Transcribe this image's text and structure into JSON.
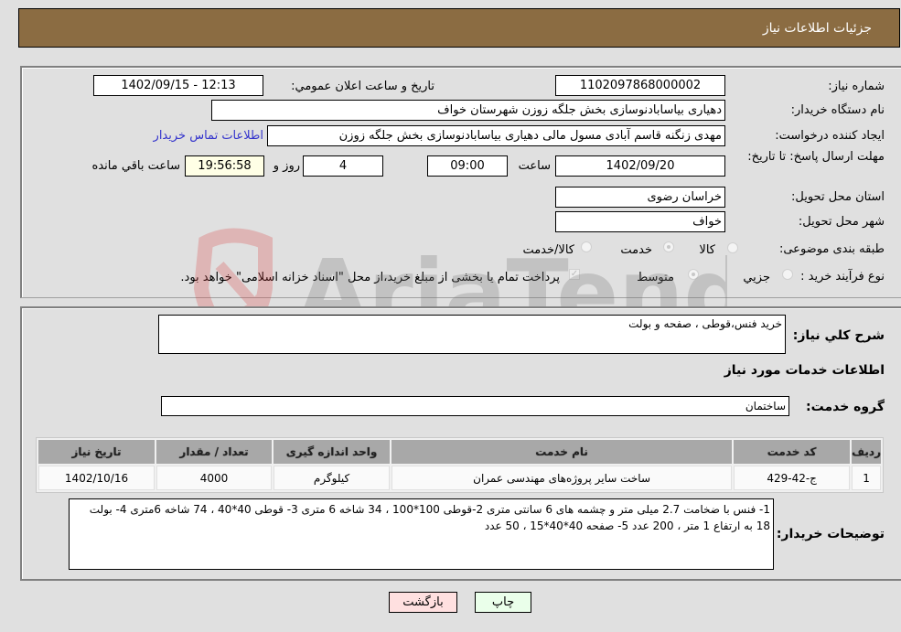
{
  "header": {
    "title": "جزئیات اطلاعات نیاز"
  },
  "fields": {
    "need_number": {
      "label": "شماره نیاز:",
      "value": "1102097868000002"
    },
    "announce_datetime": {
      "label": "تاریخ و ساعت اعلان عمومي:",
      "value": "1402/09/15 - 12:13"
    },
    "buyer_org": {
      "label": "نام دستگاه خریدار:",
      "value": "دهیاری بیاسابادنوسازی بخش جلگه زوزن شهرستان خواف"
    },
    "requester": {
      "label": "ایجاد کننده درخواست:",
      "value": "مهدی زنگنه قاسم آبادی مسول مالی دهیاری بیاسابادنوسازی بخش جلگه زوزن"
    },
    "buyer_contact_link": "اطلاعات تماس خریدار",
    "deadline": {
      "label": "مهلت ارسال پاسخ: تا تاریخ:",
      "date": "1402/09/20",
      "time_label": "ساعت",
      "time": "09:00",
      "days": "4",
      "days_label": "روز و",
      "remaining": "19:56:58",
      "remaining_label": "ساعت باقي مانده"
    },
    "province": {
      "label": "استان محل تحویل:",
      "value": "خراسان رضوی"
    },
    "city": {
      "label": "شهر محل تحویل:",
      "value": "خواف"
    },
    "category": {
      "label": "طبقه بندی موضوعی:",
      "options": [
        "کالا",
        "خدمت",
        "کالا/خدمت"
      ],
      "selected": "خدمت"
    },
    "purchase_type": {
      "label": "نوع فرآیند خرید :",
      "options": [
        "جزيي",
        "متوسط"
      ],
      "selected": "متوسط",
      "treasury_note": "پرداخت تمام یا بخشی از مبلغ خرید،از محل \"اسناد خزانه اسلامی\" خواهد بود.",
      "treasury_checked": true
    }
  },
  "details": {
    "general_desc_label": "شرح کلي نیاز:",
    "general_desc": "خرید فنس،قوطی ، صفحه و بولت",
    "services_heading": "اطلاعات خدمات مورد نیاز",
    "service_group_label": "گروه خدمت:",
    "service_group": "ساختمان",
    "table": {
      "headers": [
        "ردیف",
        "کد خدمت",
        "نام خدمت",
        "واحد اندازه گیری",
        "تعداد / مقدار",
        "تاریخ نیاز"
      ],
      "rows": [
        [
          "1",
          "ج-42-429",
          "ساخت سایر پروژه‌های مهندسی عمران",
          "کیلوگرم",
          "4000",
          "1402/10/16"
        ]
      ]
    },
    "buyer_notes_label": "توضیحات خریدار:",
    "buyer_notes": "1- فنس با ضخامت 2.7 میلی متر و چشمه های 6 سانتی متری 2-قوطی 100*100 ، 34 شاخه 6 متری 3- قوطی 40*40 ، 74 شاخه 6متری 4- بولت 18 به ارتفاع 1 متر ، 200 عدد 5- صفحه 40*40*15 ، 50 عدد"
  },
  "buttons": {
    "print": "چاپ",
    "back": "بازگشت"
  },
  "watermark": {
    "text": "AriaTender.neT"
  },
  "colors": {
    "header_bg": "#8b6c42",
    "print_bg": "#eaffea",
    "back_bg": "#ffe0e0",
    "link": "#3333cc"
  }
}
